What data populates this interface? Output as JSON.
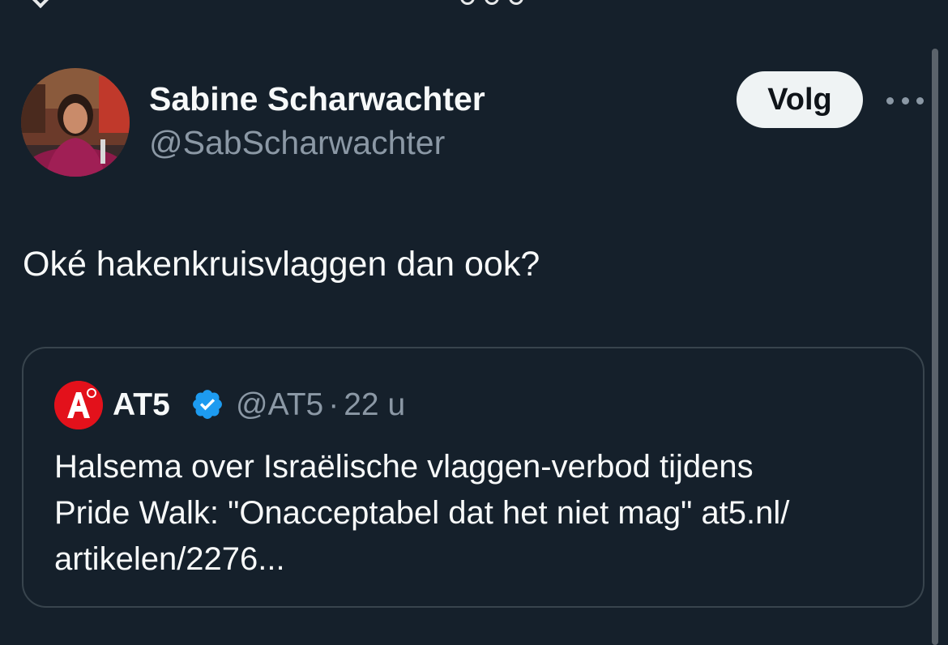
{
  "author": {
    "name": "Sabine Scharwachter",
    "handle": "@SabScharwachter",
    "follow_label": "Volg"
  },
  "tweet": {
    "text": "Oké hakenkruisvlaggen dan ook?"
  },
  "quoted_tweet": {
    "author_name": "AT5",
    "handle": "@AT5",
    "separator": "·",
    "time": "22 u",
    "avatar_letter": "A",
    "line1": "Halsema over Israëlische vlaggen-verbod tijdens",
    "line2": "Pride Walk: \"Onacceptabel dat het niet mag\" at5.nl/",
    "line3": "artikelen/2276..."
  },
  "icons": {
    "back": "chevron-left-icon",
    "more": "more-horizontal-icon",
    "verified": "verified-badge-icon"
  },
  "colors": {
    "background": "#15202b",
    "text_primary": "#f7f9f9",
    "text_secondary": "#8b98a5",
    "border": "#38444d",
    "follow_bg": "#eff3f4",
    "verified_blue": "#1d9bf0",
    "at5_red": "#e3111b"
  }
}
